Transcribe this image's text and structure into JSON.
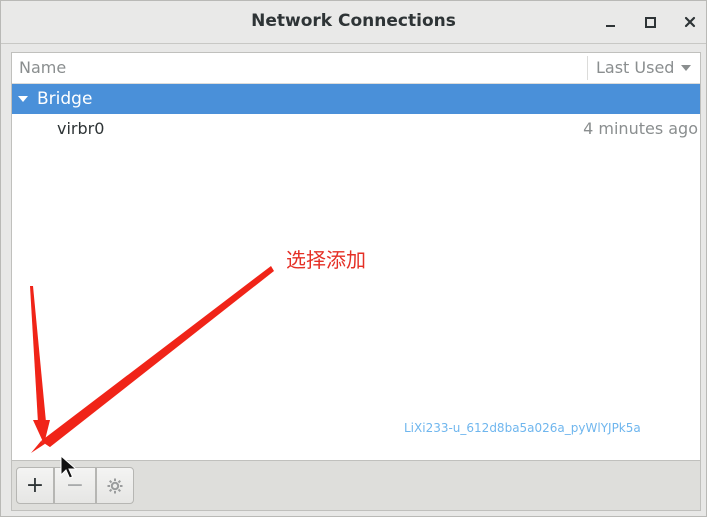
{
  "window": {
    "title": "Network Connections"
  },
  "list": {
    "columns": {
      "name": "Name",
      "last_used": "Last Used"
    },
    "groups": [
      {
        "label": "Bridge",
        "expanded": true,
        "items": [
          {
            "name": "virbr0",
            "last_used": "4 minutes ago"
          }
        ]
      }
    ]
  },
  "annotation": {
    "text": "选择添加",
    "color": "#e53026"
  },
  "watermark": "LiXi233-u_612d8ba5a026a_pyWlYJPk5a",
  "toolbar": {
    "add_label": "+",
    "remove_label": "−",
    "settings_icon": "gear-icon"
  },
  "colors": {
    "selection": "#4a90d9"
  }
}
